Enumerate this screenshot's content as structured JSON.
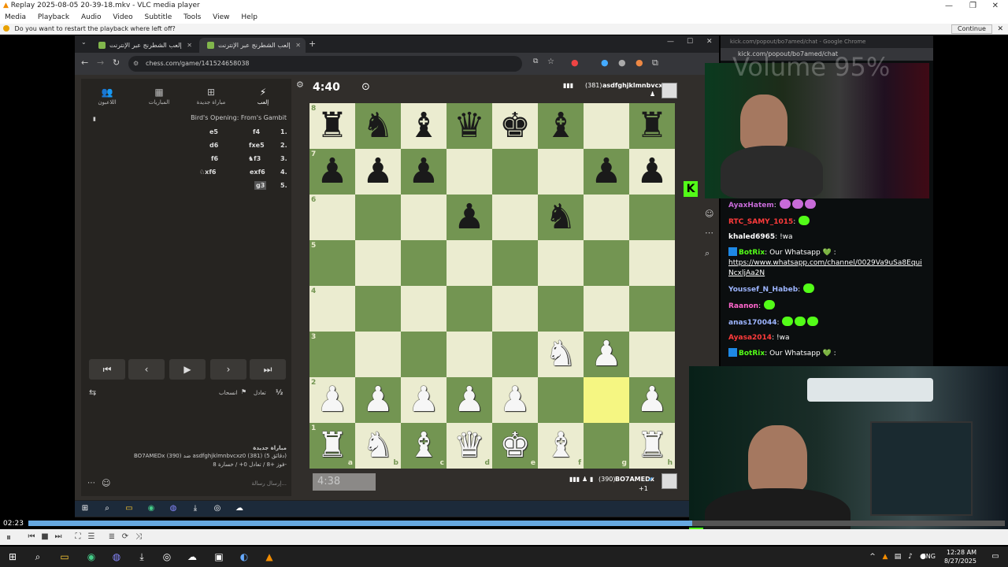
{
  "vlc": {
    "title": "Replay 2025-08-05 20-39-18.mkv - VLC media player",
    "menu": [
      "Media",
      "Playback",
      "Audio",
      "Video",
      "Subtitle",
      "Tools",
      "View",
      "Help"
    ],
    "notice": "Do you want to restart the playback where left off?",
    "continue_label": "Continue",
    "time_elapsed": "02:23",
    "progress": 0.68
  },
  "browser": {
    "tabs": [
      {
        "label": "إلعب الشطرنج عبر الإنترنت"
      },
      {
        "label": "إلعب الشطرنج عبر الإنترنت"
      }
    ],
    "url": "chess.com/game/141524658038"
  },
  "chess": {
    "nav_tabs": [
      {
        "label": "اللاعبون",
        "icon": "players-icon"
      },
      {
        "label": "المباريات",
        "icon": "games-icon"
      },
      {
        "label": "مباراة جديدة",
        "icon": "new-game-icon"
      },
      {
        "label": "إلعب",
        "icon": "play-icon"
      }
    ],
    "opening": "Bird's Opening: From's Gambit",
    "moves": [
      {
        "n": "1.",
        "white": "f4",
        "black": "e5"
      },
      {
        "n": "2.",
        "white": "fxe5",
        "black": "d6"
      },
      {
        "n": "3.",
        "white": "♞f3",
        "black": "f6"
      },
      {
        "n": "4.",
        "white": "exf6",
        "black": "♘xf6"
      },
      {
        "n": "5.",
        "white": "g3",
        "black": ""
      }
    ],
    "draw_label": "تعادل",
    "draw_icon": "½",
    "resign_label": "انسحاب",
    "new_game_title": "مباراة جديدة",
    "game_line": "BO7AMEDx (390) ضد asdfghjklmnbvcxz0 (381) (5 دقائق)",
    "result_line": "فوز +8 / تعادل 0+ / خسارة 8-",
    "chat_placeholder": "إرسال رسالة...",
    "top_clock": "4:40",
    "bottom_clock": "4:38",
    "top_player": "asdfghjklmnbvcxz0",
    "top_rating": "(381)",
    "bottom_player": "BO7AMEDx",
    "bottom_rating": "(390)",
    "bottom_extra": "+1",
    "files": [
      "a",
      "b",
      "c",
      "d",
      "e",
      "f",
      "g",
      "h"
    ],
    "ranks": [
      "8",
      "7",
      "6",
      "5",
      "4",
      "3",
      "2",
      "1"
    ],
    "board": [
      [
        "r",
        "n",
        "b",
        "q",
        "k",
        "b",
        "",
        "r"
      ],
      [
        "p",
        "p",
        "p",
        "",
        "",
        "",
        "p",
        "p"
      ],
      [
        "",
        "",
        "",
        "p",
        "",
        "n",
        "",
        ""
      ],
      [
        "",
        "",
        "",
        "",
        "",
        "",
        "",
        ""
      ],
      [
        "",
        "",
        "",
        "",
        "",
        "",
        "",
        ""
      ],
      [
        "",
        "",
        "",
        "",
        "",
        "N",
        "P",
        ""
      ],
      [
        "P",
        "P",
        "P",
        "P",
        "P",
        "",
        "",
        "P"
      ],
      [
        "R",
        "N",
        "B",
        "Q",
        "K",
        "B",
        "",
        "R"
      ]
    ],
    "highlight": [
      [
        6,
        6
      ]
    ]
  },
  "kick": {
    "window_title": "kick.com/popout/bo7amed/chat - Google Chrome",
    "url": "kick.com/popout/bo7amed/chat",
    "volume_overlay": "Volume 95%",
    "messages": [
      {
        "user": "AyaxHatem",
        "color": "#c86bd9",
        "text": "",
        "emotes": 3
      },
      {
        "user": "RTC_SAMY_1015",
        "color": "#ff3b3b",
        "text": "",
        "emotes": 1
      },
      {
        "user": "khaled6965",
        "color": "#ffffff",
        "text": "!wa",
        "emotes": 0
      },
      {
        "user": "BotRix",
        "color": "#53fc18",
        "text": "Our Whatsapp 💚 :",
        "link": "https://www.whatsapp.com/channel/0029Va9uSa8Equi NcxljAa2N",
        "emotes": 0
      },
      {
        "user": "Youssef_N_Habeb",
        "color": "#9db5ff",
        "text": "",
        "emotes": 1
      },
      {
        "user": "Raanon",
        "color": "#ff66cc",
        "text": "",
        "emotes": 1
      },
      {
        "user": "anas170044",
        "color": "#9db5ff",
        "text": "",
        "emotes": 3
      },
      {
        "user": "Ayasa2014",
        "color": "#ff3b3b",
        "text": "!wa",
        "emotes": 0
      },
      {
        "user": "BotRix",
        "color": "#53fc18",
        "text": "Our Whatsapp 💚 :",
        "emotes": 0
      }
    ]
  },
  "taskbar": {
    "time": "12:28 AM",
    "date": "8/27/2025",
    "lang": "ENG"
  }
}
